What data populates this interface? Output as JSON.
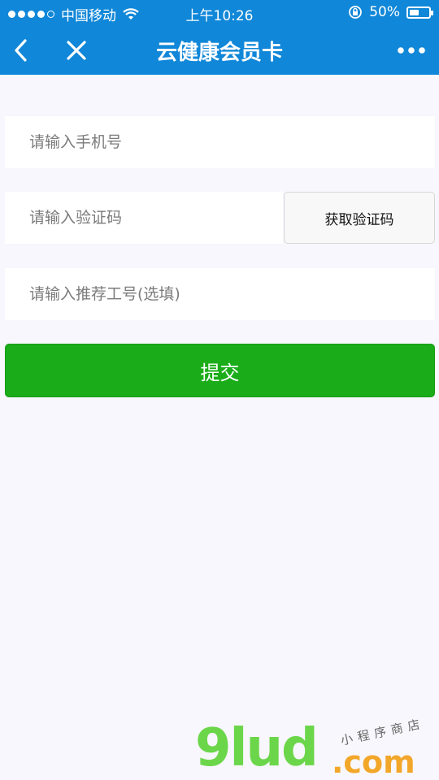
{
  "status_bar": {
    "carrier": "中国移动",
    "time": "上午10:26",
    "battery_percent": "50%",
    "battery_level": 0.5
  },
  "nav": {
    "title": "云健康会员卡",
    "back_icon": "chevron-left-icon",
    "close_icon": "close-icon",
    "more_icon": "more-dots-icon"
  },
  "form": {
    "phone_placeholder": "请输入手机号",
    "code_placeholder": "请输入验证码",
    "get_code_label": "获取验证码",
    "referrer_placeholder": "请输入推荐工号(选填)",
    "submit_label": "提交"
  },
  "watermark": {
    "logo": "9lud",
    "domain": ".com",
    "tagline": "小程序商店"
  },
  "colors": {
    "header": "#1087d8",
    "submit": "#1aad19",
    "background": "#f8f7fd"
  }
}
